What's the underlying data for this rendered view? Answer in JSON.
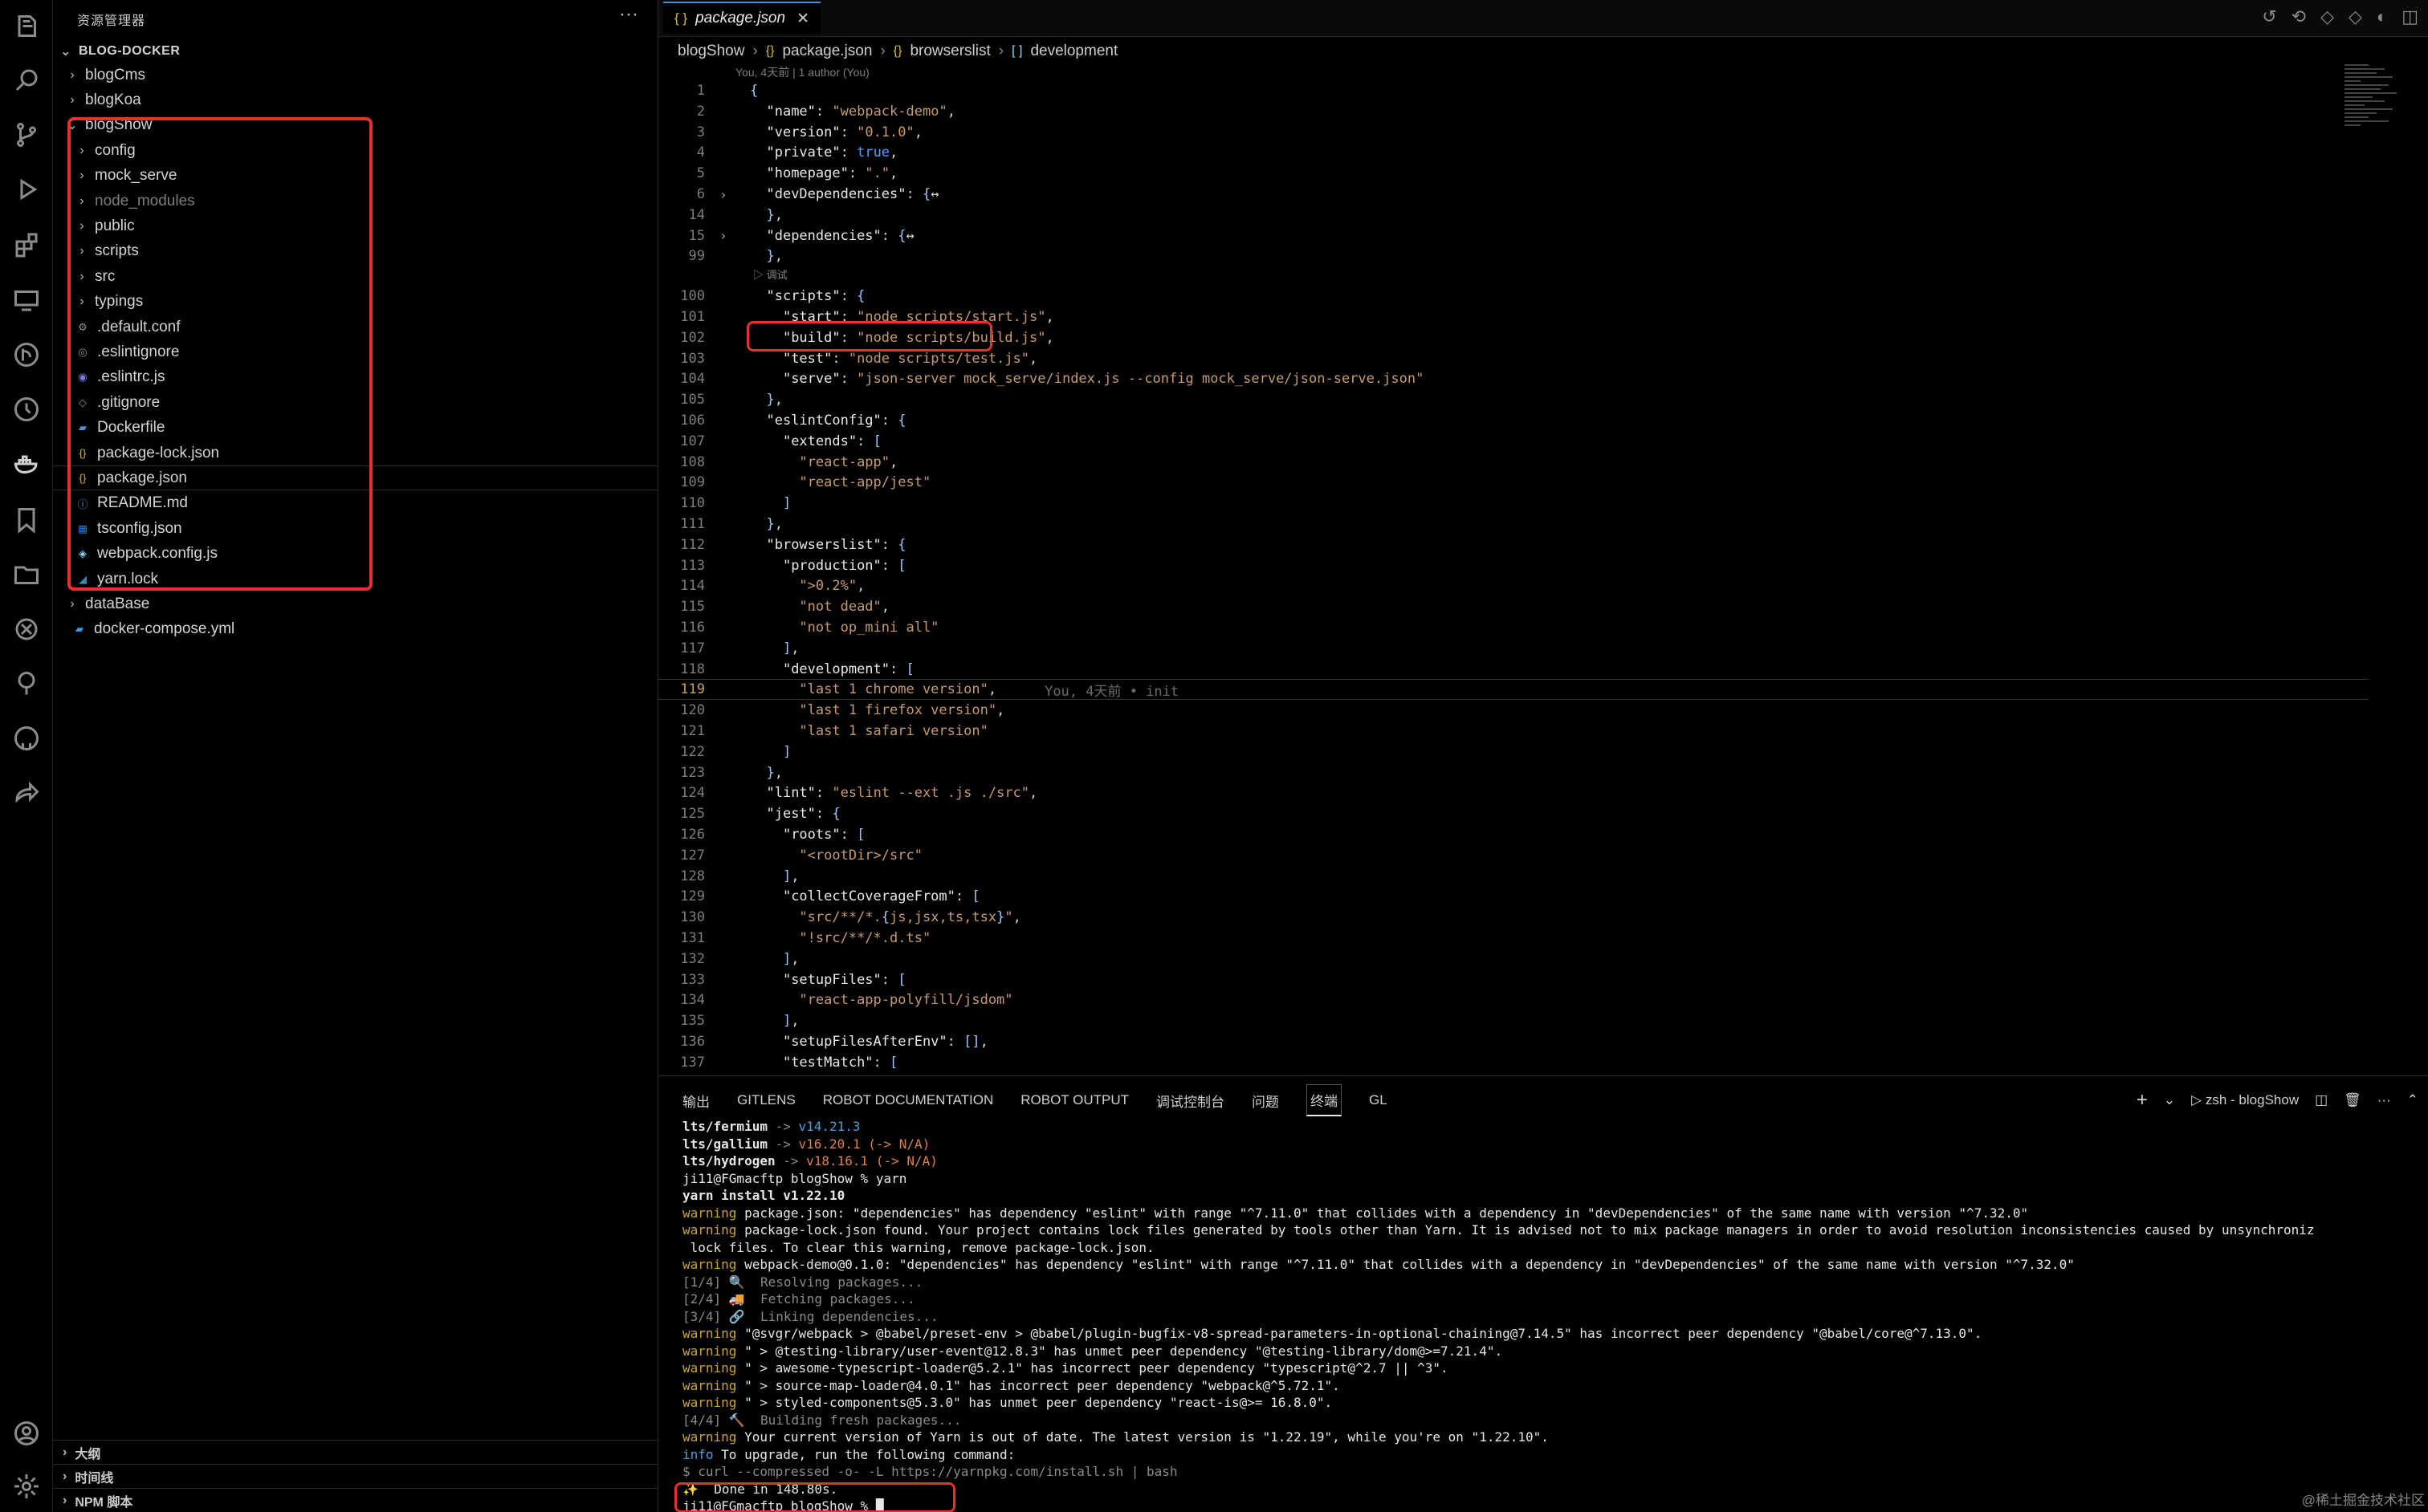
{
  "sidebar": {
    "title": "资源管理器",
    "root": "BLOG-DOCKER",
    "items": [
      {
        "label": "blogCms",
        "type": "folder",
        "level": 1,
        "expanded": false
      },
      {
        "label": "blogKoa",
        "type": "folder",
        "level": 1,
        "expanded": false
      },
      {
        "label": "blogShow",
        "type": "folder",
        "level": 1,
        "expanded": true
      },
      {
        "label": "config",
        "type": "folder",
        "level": 2,
        "expanded": false
      },
      {
        "label": "mock_serve",
        "type": "folder",
        "level": 2,
        "expanded": false
      },
      {
        "label": "node_modules",
        "type": "folder",
        "level": 2,
        "expanded": false,
        "dim": true
      },
      {
        "label": "public",
        "type": "folder",
        "level": 2,
        "expanded": false
      },
      {
        "label": "scripts",
        "type": "folder",
        "level": 2,
        "expanded": false
      },
      {
        "label": "src",
        "type": "folder",
        "level": 2,
        "expanded": false
      },
      {
        "label": "typings",
        "type": "folder",
        "level": 2,
        "expanded": false
      },
      {
        "label": ".default.conf",
        "type": "gear",
        "level": 2
      },
      {
        "label": ".eslintignore",
        "type": "circle",
        "level": 2
      },
      {
        "label": ".eslintrc.js",
        "type": "eslint",
        "level": 2
      },
      {
        "label": ".gitignore",
        "type": "git",
        "level": 2
      },
      {
        "label": "Dockerfile",
        "type": "docker",
        "level": 2
      },
      {
        "label": "package-lock.json",
        "type": "json",
        "level": 2
      },
      {
        "label": "package.json",
        "type": "json",
        "level": 2,
        "selected": true
      },
      {
        "label": "README.md",
        "type": "info",
        "level": 2
      },
      {
        "label": "tsconfig.json",
        "type": "ts",
        "level": 2
      },
      {
        "label": "webpack.config.js",
        "type": "webpack",
        "level": 2
      },
      {
        "label": "yarn.lock",
        "type": "yarn",
        "level": 2
      },
      {
        "label": "dataBase",
        "type": "folder",
        "level": 1,
        "expanded": false
      },
      {
        "label": "docker-compose.yml",
        "type": "docker",
        "level": 1
      }
    ],
    "sections": [
      "大纲",
      "时间线",
      "NPM 脚本"
    ]
  },
  "editor": {
    "tab_label": "package.json",
    "breadcrumb": [
      "blogShow",
      "package.json",
      "browserslist",
      "development"
    ],
    "blame_header": "You, 4天前 | 1 author (You)",
    "codelens": "▷ 调试",
    "blame_inline": "You, 4天前 • init",
    "lines": [
      {
        "n": "1",
        "t": "{"
      },
      {
        "n": "2",
        "t": "  \"name\": \"webpack-demo\","
      },
      {
        "n": "3",
        "t": "  \"version\": \"0.1.0\","
      },
      {
        "n": "4",
        "t": "  \"private\": true,"
      },
      {
        "n": "5",
        "t": "  \"homepage\": \".\","
      },
      {
        "n": "6",
        "t": "  \"devDependencies\": {↔",
        "fold": true
      },
      {
        "n": "14",
        "t": "  },"
      },
      {
        "n": "15",
        "t": "  \"dependencies\": {↔",
        "fold": true
      },
      {
        "n": "99",
        "t": "  },"
      },
      {
        "n": "100",
        "t": "  \"scripts\": {"
      },
      {
        "n": "101",
        "t": "    \"start\": \"node scripts/start.js\","
      },
      {
        "n": "102",
        "t": "    \"build\": \"node scripts/build.js\","
      },
      {
        "n": "103",
        "t": "    \"test\": \"node scripts/test.js\","
      },
      {
        "n": "104",
        "t": "    \"serve\": \"json-server mock_serve/index.js --config mock_serve/json-serve.json\""
      },
      {
        "n": "105",
        "t": "  },"
      },
      {
        "n": "106",
        "t": "  \"eslintConfig\": {"
      },
      {
        "n": "107",
        "t": "    \"extends\": ["
      },
      {
        "n": "108",
        "t": "      \"react-app\","
      },
      {
        "n": "109",
        "t": "      \"react-app/jest\""
      },
      {
        "n": "110",
        "t": "    ]"
      },
      {
        "n": "111",
        "t": "  },"
      },
      {
        "n": "112",
        "t": "  \"browserslist\": {"
      },
      {
        "n": "113",
        "t": "    \"production\": ["
      },
      {
        "n": "114",
        "t": "      \">0.2%\","
      },
      {
        "n": "115",
        "t": "      \"not dead\","
      },
      {
        "n": "116",
        "t": "      \"not op_mini all\""
      },
      {
        "n": "117",
        "t": "    ],"
      },
      {
        "n": "118",
        "t": "    \"development\": ["
      },
      {
        "n": "119",
        "t": "      \"last 1 chrome version\","
      },
      {
        "n": "120",
        "t": "      \"last 1 firefox version\","
      },
      {
        "n": "121",
        "t": "      \"last 1 safari version\""
      },
      {
        "n": "122",
        "t": "    ]"
      },
      {
        "n": "123",
        "t": "  },"
      },
      {
        "n": "124",
        "t": "  \"lint\": \"eslint --ext .js ./src\","
      },
      {
        "n": "125",
        "t": "  \"jest\": {"
      },
      {
        "n": "126",
        "t": "    \"roots\": ["
      },
      {
        "n": "127",
        "t": "      \"<rootDir>/src\""
      },
      {
        "n": "128",
        "t": "    ],"
      },
      {
        "n": "129",
        "t": "    \"collectCoverageFrom\": ["
      },
      {
        "n": "130",
        "t": "      \"src/**/*.{js,jsx,ts,tsx}\","
      },
      {
        "n": "131",
        "t": "      \"!src/**/*.d.ts\""
      },
      {
        "n": "132",
        "t": "    ],"
      },
      {
        "n": "133",
        "t": "    \"setupFiles\": ["
      },
      {
        "n": "134",
        "t": "      \"react-app-polyfill/jsdom\""
      },
      {
        "n": "135",
        "t": "    ],"
      },
      {
        "n": "136",
        "t": "    \"setupFilesAfterEnv\": [],"
      },
      {
        "n": "137",
        "t": "    \"testMatch\": ["
      }
    ]
  },
  "panel": {
    "tabs": [
      "输出",
      "GITLENS",
      "ROBOT DOCUMENTATION",
      "ROBOT OUTPUT",
      "调试控制台",
      "问题",
      "终端",
      "GL"
    ],
    "active_tab": "终端",
    "terminal_name": "zsh - blogShow",
    "terminal_lines": [
      {
        "c": "bold",
        "t": "lts/fermium -> v14.21.3"
      },
      {
        "c": "bold",
        "t": "lts/gallium -> v16.20.1 (-> N/A)"
      },
      {
        "c": "bold",
        "t": "lts/hydrogen -> v18.16.1 (-> N/A)"
      },
      {
        "c": "",
        "t": "ji11@FGmacftp blogShow % yarn"
      },
      {
        "c": "bold",
        "t": "yarn install v1.22.10"
      },
      {
        "c": "warn",
        "t": "warning package.json: \"dependencies\" has dependency \"eslint\" with range \"^7.11.0\" that collides with a dependency in \"devDependencies\" of the same name with version \"^7.32.0\""
      },
      {
        "c": "warn",
        "t": "warning package-lock.json found. Your project contains lock files generated by tools other than Yarn. It is advised not to mix package managers in order to avoid resolution inconsistencies caused by unsynchroniz"
      },
      {
        "c": "",
        "t": " lock files. To clear this warning, remove package-lock.json."
      },
      {
        "c": "warn",
        "t": "warning webpack-demo@0.1.0: \"dependencies\" has dependency \"eslint\" with range \"^7.11.0\" that collides with a dependency in \"devDependencies\" of the same name with version \"^7.32.0\""
      },
      {
        "c": "dim",
        "t": "[1/4] 🔍  Resolving packages..."
      },
      {
        "c": "dim",
        "t": "[2/4] 🚚  Fetching packages..."
      },
      {
        "c": "dim",
        "t": "[3/4] 🔗  Linking dependencies..."
      },
      {
        "c": "warn",
        "t": "warning \"@svgr/webpack > @babel/preset-env > @babel/plugin-bugfix-v8-spread-parameters-in-optional-chaining@7.14.5\" has incorrect peer dependency \"@babel/core@^7.13.0\"."
      },
      {
        "c": "warn",
        "t": "warning \" > @testing-library/user-event@12.8.3\" has unmet peer dependency \"@testing-library/dom@>=7.21.4\"."
      },
      {
        "c": "warn",
        "t": "warning \" > awesome-typescript-loader@5.2.1\" has incorrect peer dependency \"typescript@^2.7 || ^3\"."
      },
      {
        "c": "warn",
        "t": "warning \" > source-map-loader@4.0.1\" has incorrect peer dependency \"webpack@^5.72.1\"."
      },
      {
        "c": "warn",
        "t": "warning \" > styled-components@5.3.0\" has unmet peer dependency \"react-is@>= 16.8.0\"."
      },
      {
        "c": "dim",
        "t": "[4/4] 🔨  Building fresh packages..."
      },
      {
        "c": "warn",
        "t": "warning Your current version of Yarn is out of date. The latest version is \"1.22.19\", while you're on \"1.22.10\"."
      },
      {
        "c": "info",
        "t": "info To upgrade, run the following command:"
      },
      {
        "c": "dim",
        "t": "$ curl --compressed -o- -L https://yarnpkg.com/install.sh | bash"
      },
      {
        "c": "",
        "t": "✨  Done in 148.80s."
      },
      {
        "c": "",
        "t": "ji11@FGmacftp blogShow % █"
      }
    ]
  },
  "watermark": "@稀土掘金技术社区",
  "colors": {
    "accent_red": "#e5322d",
    "string": "#c59a6f",
    "bracket": "#4fa0ff"
  }
}
